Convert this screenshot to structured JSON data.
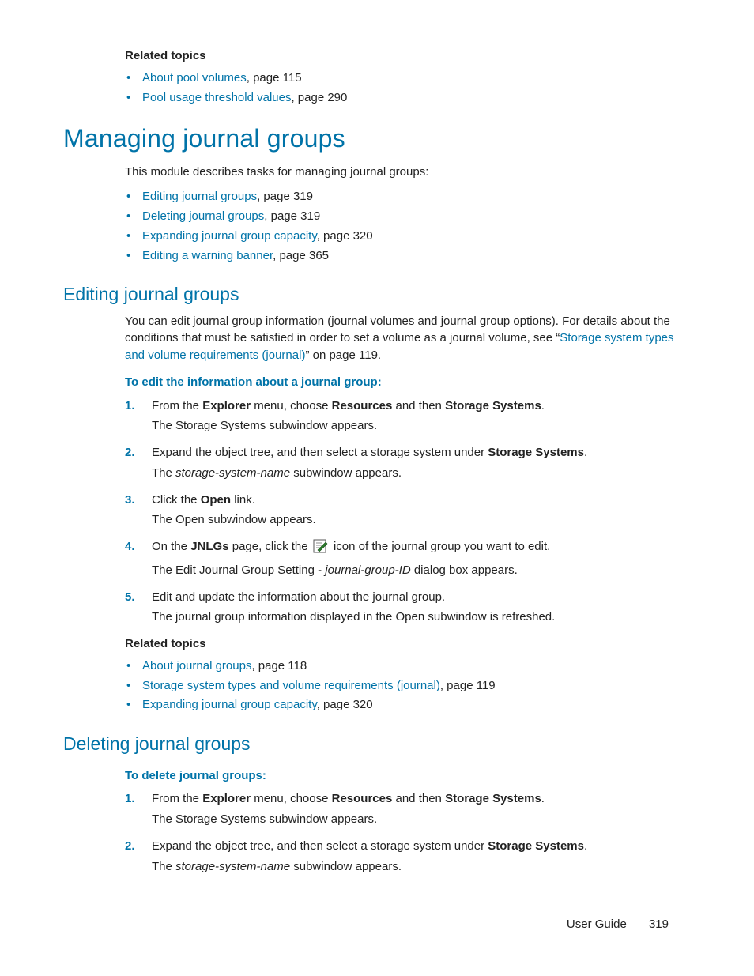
{
  "relTop": {
    "title": "Related topics",
    "items": [
      {
        "link": "About pool volumes",
        "tail": ", page 115"
      },
      {
        "link": "Pool usage threshold values",
        "tail": ", page 290"
      }
    ]
  },
  "h1": "Managing journal groups",
  "intro": "This module describes tasks for managing journal groups:",
  "introLinks": [
    {
      "link": "Editing journal groups",
      "tail": ", page 319"
    },
    {
      "link": "Deleting journal groups",
      "tail": ", page 319"
    },
    {
      "link": "Expanding journal group capacity",
      "tail": ", page 320"
    },
    {
      "link": "Editing a warning banner",
      "tail": ", page 365"
    }
  ],
  "edit": {
    "heading": "Editing journal groups",
    "para1a": "You can edit journal group information (journal volumes and journal group options). For details about the conditions that must be satisfied in order to set a volume as a journal volume, see “",
    "para1link": "Storage system types and volume requirements (journal)",
    "para1b": "” on page 119.",
    "procTitle": "To edit the information about a journal group:",
    "steps": {
      "s1a": "From the ",
      "s1b": "Explorer",
      "s1c": " menu, choose ",
      "s1d": "Resources",
      "s1e": " and then ",
      "s1f": "Storage Systems",
      "s1g": ".",
      "s1sub": "The Storage Systems subwindow appears.",
      "s2a": "Expand the object tree, and then select a storage system under ",
      "s2b": "Storage Systems",
      "s2c": ".",
      "s2subA": "The ",
      "s2subB": "storage-system-name",
      "s2subC": " subwindow appears.",
      "s3a": "Click the ",
      "s3b": "Open",
      "s3c": " link.",
      "s3sub": "The Open subwindow appears.",
      "s4a": "On the ",
      "s4b": "JNLGs",
      "s4c": " page, click the ",
      "s4d": " icon of the journal group you want to edit.",
      "s4subA": "The Edit Journal Group Setting - ",
      "s4subB": "journal-group-ID",
      "s4subC": " dialog box appears.",
      "s5": "Edit and update the information about the journal group.",
      "s5sub": "The journal group information displayed in the Open subwindow is refreshed."
    },
    "rel": {
      "title": "Related topics",
      "items": [
        {
          "link": "About journal groups",
          "tail": ", page 118"
        },
        {
          "link": "Storage system types and volume requirements (journal)",
          "tail": ", page 119"
        },
        {
          "link": "Expanding journal group capacity",
          "tail": ", page 320"
        }
      ]
    }
  },
  "del": {
    "heading": "Deleting journal groups",
    "procTitle": "To delete journal groups:",
    "steps": {
      "s1a": "From the ",
      "s1b": "Explorer",
      "s1c": " menu, choose ",
      "s1d": "Resources",
      "s1e": " and then ",
      "s1f": "Storage Systems",
      "s1g": ".",
      "s1sub": "The Storage Systems subwindow appears.",
      "s2a": "Expand the object tree, and then select a storage system under ",
      "s2b": "Storage Systems",
      "s2c": ".",
      "s2subA": "The ",
      "s2subB": "storage-system-name",
      "s2subC": " subwindow appears."
    }
  },
  "footer": {
    "label": "User Guide",
    "page": "319"
  }
}
